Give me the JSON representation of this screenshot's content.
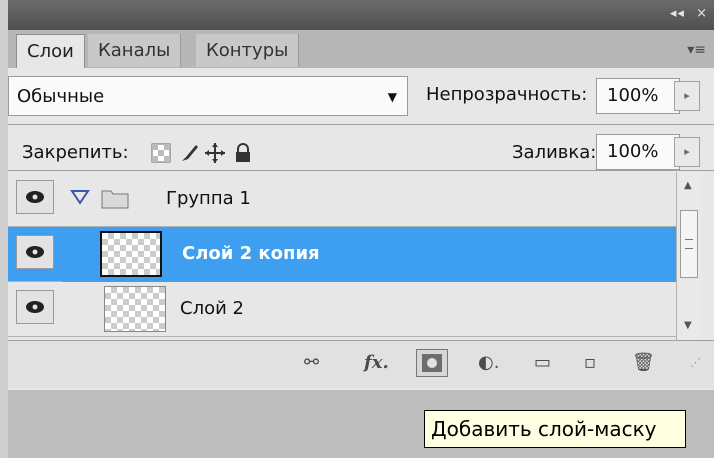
{
  "tabs": [
    "Слои",
    "Каналы",
    "Контуры"
  ],
  "blend_mode": "Обычные",
  "opacity": {
    "label": "Непрозрачность:",
    "value": "100%"
  },
  "lock": {
    "label": "Закрепить:"
  },
  "fill": {
    "label": "Заливка:",
    "value": "100%"
  },
  "layers": [
    {
      "name": "Группа 1",
      "type": "group",
      "visible": true
    },
    {
      "name": "Слой 2 копия",
      "type": "layer",
      "visible": true,
      "selected": true
    },
    {
      "name": "Слой 2",
      "type": "layer",
      "visible": true
    }
  ],
  "tooltip": "Добавить слой-маску",
  "icons": {
    "title_buttons": [
      "collapse-icon",
      "close-icon"
    ],
    "panel_menu": "panel-menu-icon",
    "bottom": [
      "link-layers-icon",
      "fx-icon",
      "add-mask-icon",
      "adjustment-icon",
      "new-group-icon",
      "new-layer-icon",
      "trash-icon"
    ]
  },
  "colors": {
    "selection": "#3e9ef0",
    "panel": "#e7e7e7",
    "titlebar": "#5a5a5a"
  }
}
